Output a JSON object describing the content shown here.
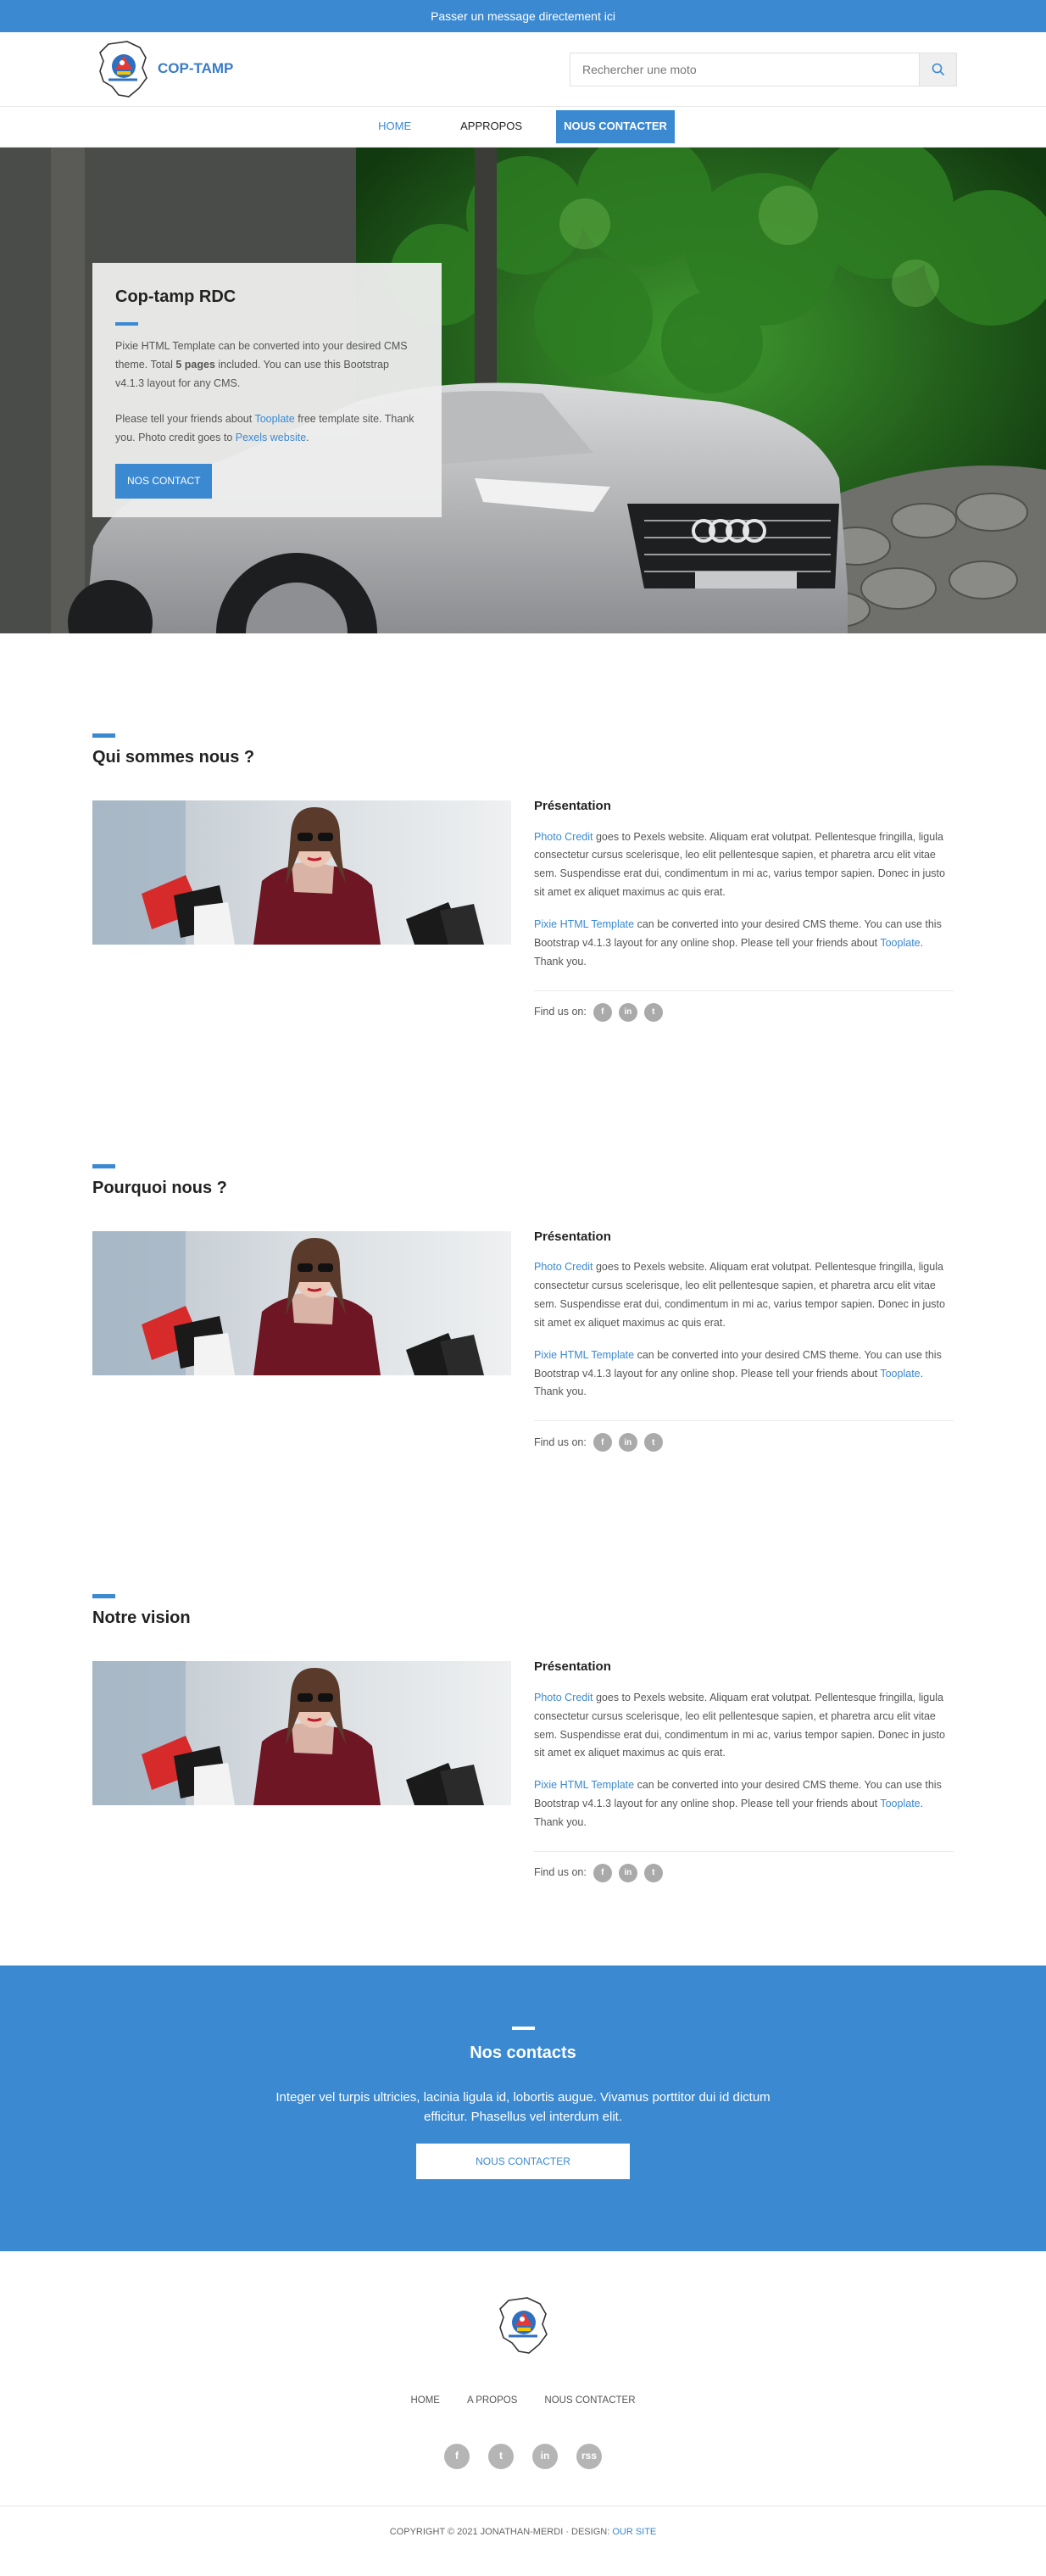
{
  "topbar": {
    "text": "Passer un message directement ici"
  },
  "header": {
    "brand": "COP-TAMP",
    "search": {
      "placeholder": "Rechercher une moto"
    }
  },
  "nav": {
    "items": [
      "HOME",
      "APPROPOS",
      "NOUS CONTACTER"
    ]
  },
  "hero": {
    "title": "Cop-tamp RDC",
    "p1": {
      "t1": "Pixie HTML Template can be converted into your desired CMS theme. Total ",
      "bold": "5 pages",
      "t2": " included. You can use this Bootstrap v4.1.3 layout for any CMS."
    },
    "p2": {
      "t1": "Please tell your friends about ",
      "link1": "Tooplate",
      "t2": " free template site. Thank you. Photo credit goes to ",
      "link2": "Pexels website",
      "t3": "."
    },
    "button": "NOS CONTACT"
  },
  "sections": [
    {
      "title": "Qui sommes nous ?",
      "subtitle": "Présentation",
      "p1_link": "Photo Credit",
      "p1_text": " goes to Pexels website. Aliquam erat volutpat. Pellentesque fringilla, ligula consectetur cursus scelerisque, leo elit pellentesque sapien, et pharetra arcu elit vitae sem. Suspendisse erat dui, condimentum in mi ac, varius tempor sapien. Donec in justo sit amet ex aliquet maximus ac quis erat.",
      "p2_link": "Pixie HTML Template",
      "p2_text": " can be converted into your desired CMS theme. You can use this Bootstrap v4.1.3 layout for any online shop. Please tell your friends about ",
      "p2_link2": "Tooplate",
      "p2_end": ". Thank you.",
      "find": "Find us on:"
    },
    {
      "title": "Pourquoi nous ?",
      "subtitle": "Présentation",
      "p1_link": "Photo Credit",
      "p1_text": " goes to Pexels website. Aliquam erat volutpat. Pellentesque fringilla, ligula consectetur cursus scelerisque, leo elit pellentesque sapien, et pharetra arcu elit vitae sem. Suspendisse erat dui, condimentum in mi ac, varius tempor sapien. Donec in justo sit amet ex aliquet maximus ac quis erat.",
      "p2_link": "Pixie HTML Template",
      "p2_text": " can be converted into your desired CMS theme. You can use this Bootstrap v4.1.3 layout for any online shop. Please tell your friends about ",
      "p2_link2": "Tooplate",
      "p2_end": ". Thank you.",
      "find": "Find us on:"
    },
    {
      "title": "Notre vision",
      "subtitle": "Présentation",
      "p1_link": "Photo Credit",
      "p1_text": " goes to Pexels website. Aliquam erat volutpat. Pellentesque fringilla, ligula consectetur cursus scelerisque, leo elit pellentesque sapien, et pharetra arcu elit vitae sem. Suspendisse erat dui, condimentum in mi ac, varius tempor sapien. Donec in justo sit amet ex aliquet maximus ac quis erat.",
      "p2_link": "Pixie HTML Template",
      "p2_text": " can be converted into your desired CMS theme. You can use this Bootstrap v4.1.3 layout for any online shop. Please tell your friends about ",
      "p2_link2": "Tooplate",
      "p2_end": ". Thank you.",
      "find": "Find us on:"
    }
  ],
  "social_small": [
    "f",
    "in",
    "t"
  ],
  "contact": {
    "title": "Nos contacts",
    "text": "Integer vel turpis ultricies, lacinia ligula id, lobortis augue. Vivamus porttitor dui id dictum efficitur. Phasellus vel interdum elit.",
    "button": "NOUS CONTACTER"
  },
  "footer": {
    "nav": [
      "HOME",
      "A PROPOS",
      "NOUS CONTACTER"
    ],
    "social": [
      "f",
      "t",
      "in",
      "rss"
    ],
    "copyright": "COPYRIGHT © 2021 JONATHAN-MERDI · DESIGN: ",
    "copyright_link": "OUR SITE"
  },
  "colors": {
    "accent": "#3a89d1",
    "text": "#333333",
    "muted": "#555555"
  }
}
